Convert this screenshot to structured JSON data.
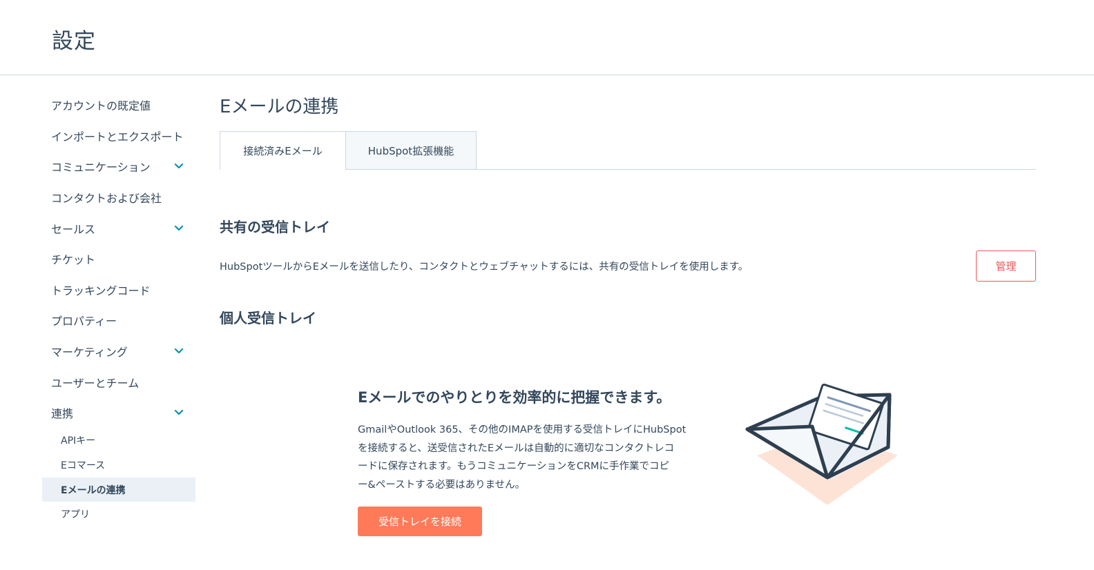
{
  "header": {
    "title": "設定"
  },
  "sidebar": {
    "items": [
      {
        "label": "アカウントの既定値"
      },
      {
        "label": "インポートとエクスポート"
      },
      {
        "label": "コミュニケーション"
      },
      {
        "label": "コンタクトおよび会社"
      },
      {
        "label": "セールス"
      },
      {
        "label": "チケット"
      },
      {
        "label": "トラッキングコード"
      },
      {
        "label": "プロパティー"
      },
      {
        "label": "マーケティング"
      },
      {
        "label": "ユーザーとチーム"
      },
      {
        "label": "連携"
      }
    ],
    "sub_items": [
      {
        "label": "APIキー"
      },
      {
        "label": "Eコマース"
      },
      {
        "label": "Eメールの連携"
      },
      {
        "label": "アプリ"
      }
    ]
  },
  "main": {
    "title": "Eメールの連携",
    "tabs": [
      {
        "label": "接続済みEメール"
      },
      {
        "label": "HubSpot拡張機能"
      }
    ],
    "shared_inbox": {
      "heading": "共有の受信トレイ",
      "description": "HubSpotツールからEメールを送信したり、コンタクトとウェブチャットするには、共有の受信トレイを使用します。",
      "manage_label": "管理"
    },
    "personal_inbox": {
      "heading": "個人受信トレイ"
    },
    "promo": {
      "title": "Eメールでのやりとりを効率的に把握できます。",
      "lines": [
        "GmailやOutlook 365、その他のIMAPを使用する受信トレイにHubSpot",
        "を接続すると、送受信されたEメールは自動的に適切なコンタクトレコ",
        "ードに保存されます。もうコミュニケーションをCRMに手作業でコピ",
        "ー&ペーストする必要はありません。"
      ],
      "button_label": "受信トレイを接続"
    }
  },
  "colors": {
    "text": "#33475b",
    "accent_orange": "#ff7a59",
    "danger_red": "#f2545b",
    "active_bg": "#eaf0f6",
    "chevron": "#0091ae",
    "border": "#cbd6e2"
  },
  "icons": {
    "expand": "chevron-down-icon",
    "illustration": "envelope-illustration"
  }
}
